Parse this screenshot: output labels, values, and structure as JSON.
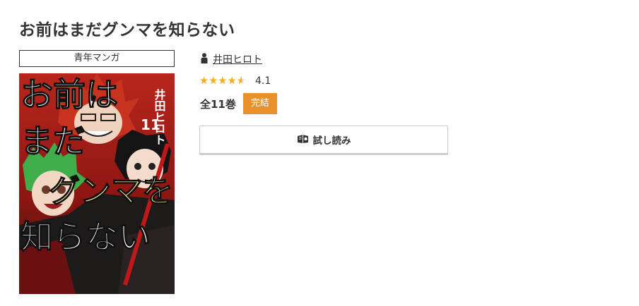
{
  "book": {
    "title": "お前はまだグンマを知らない",
    "genre": "青年マンガ",
    "author": "井田ヒロト",
    "rating": 4.1,
    "rating_text": "4.1",
    "rating_max": 5,
    "volumes": "全11巻",
    "status_badge": "完結",
    "trial_button_label": "試し読み"
  },
  "cover": {
    "title_lines": [
      "お前は",
      "まだ",
      "グンマを",
      "知らない"
    ],
    "author": "井田ヒロト",
    "volume_number": "11"
  },
  "icons": {
    "author": "person-icon",
    "trial": "open-book-icon",
    "rating": "star-icon"
  },
  "colors": {
    "star_filled": "#f2b01e",
    "star_empty": "#d5d5d5",
    "badge": "#e8912a",
    "text": "#333333"
  }
}
